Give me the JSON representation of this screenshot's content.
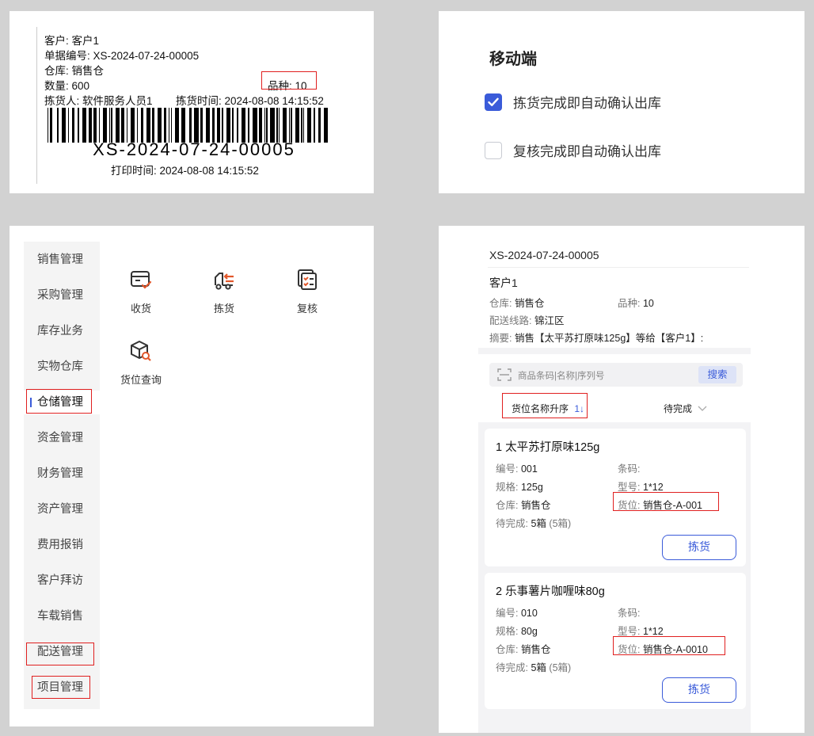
{
  "label": {
    "customer_line": "客户: 客户1",
    "doc_no_line": "单据编号: XS-2024-07-24-00005",
    "warehouse_line": "仓库: 销售仓",
    "quantity_line": "数量: 600",
    "variety_line": "品种: 10",
    "picker_line": "拣货人: 软件服务人员1",
    "pick_time_line": "拣货时间: 2024-08-08 14:15:52",
    "barcode_text": "XS-2024-07-24-00005",
    "print_time_line": "打印时间: 2024-08-08 14:15:52"
  },
  "settings": {
    "title": "移动端",
    "options": [
      {
        "label": "拣货完成即自动确认出库",
        "checked": true
      },
      {
        "label": "复核完成即自动确认出库",
        "checked": false
      }
    ],
    "accent": "#3a5bd9"
  },
  "nav": {
    "sidebar": [
      "销售管理",
      "采购管理",
      "库存业务",
      "实物仓库",
      "仓储管理",
      "资金管理",
      "财务管理",
      "资产管理",
      "费用报销",
      "客户拜访",
      "车载销售",
      "配送管理",
      "项目管理"
    ],
    "active_index": 4,
    "grid": [
      {
        "label": "收货",
        "icon": "receive-icon"
      },
      {
        "label": "拣货",
        "icon": "pick-truck-icon"
      },
      {
        "label": "复核",
        "icon": "review-icon"
      },
      {
        "label": "货位查询",
        "icon": "location-search-icon"
      }
    ]
  },
  "order": {
    "doc_no": "XS-2024-07-24-00005",
    "customer": "客户1",
    "warehouse_key": "仓库:",
    "warehouse_val": "销售仓",
    "variety_key": "品种:",
    "variety_val": "10",
    "route_key": "配送线路:",
    "route_val": "锦江区",
    "summary_key": "摘要:",
    "summary_val": "销售【太平苏打原味125g】等给【客户1】:",
    "search_placeholder": "商品条码|名称|序列号",
    "search_button": "搜索",
    "sort_label": "货位名称升序",
    "sort_icon": "1↓",
    "filter_label": "待完成",
    "items": [
      {
        "title": "1  太平苏打原味125g",
        "code_key": "编号:",
        "code_val": "001",
        "barcode_key": "条码:",
        "barcode_val": "",
        "spec_key": "规格:",
        "spec_val": "125g",
        "model_key": "型号:",
        "model_val": "1*12",
        "wh_key": "仓库:",
        "wh_val": "销售仓",
        "loc_key": "货位:",
        "loc_val": "销售仓-A-001",
        "pending_key": "待完成:",
        "pending_val": "5箱",
        "pending_extra": "(5箱)",
        "button": "拣货"
      },
      {
        "title": "2  乐事薯片咖喱味80g",
        "code_key": "编号:",
        "code_val": "010",
        "barcode_key": "条码:",
        "barcode_val": "",
        "spec_key": "规格:",
        "spec_val": "80g",
        "model_key": "型号:",
        "model_val": "1*12",
        "wh_key": "仓库:",
        "wh_val": "销售仓",
        "loc_key": "货位:",
        "loc_val": "销售仓-A-0010",
        "pending_key": "待完成:",
        "pending_val": "5箱",
        "pending_extra": "(5箱)",
        "button": "拣货"
      }
    ]
  }
}
